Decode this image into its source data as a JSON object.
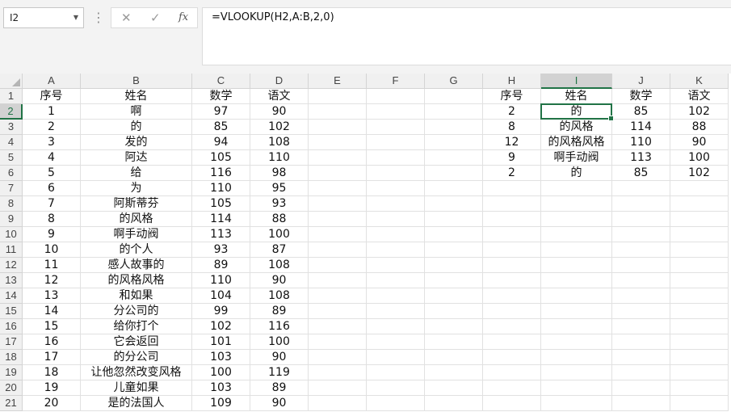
{
  "name_box": {
    "value": "I2"
  },
  "formula_bar": {
    "cancel_icon": "✕",
    "enter_icon": "✓",
    "fx_label": "fx",
    "formula": "=VLOOKUP(H2,A:B,2,0)"
  },
  "columns": [
    "A",
    "B",
    "C",
    "D",
    "E",
    "F",
    "G",
    "H",
    "I",
    "J",
    "K"
  ],
  "rows": [
    "1",
    "2",
    "3",
    "4",
    "5",
    "6",
    "7",
    "8",
    "9",
    "10",
    "11",
    "12",
    "13",
    "14",
    "15",
    "16",
    "17",
    "18",
    "19",
    "20",
    "21"
  ],
  "selected_cell": {
    "col": "I",
    "row": "2"
  },
  "cells": [
    [
      "序号",
      "姓名",
      "数学",
      "语文",
      "",
      "",
      "",
      "序号",
      "姓名",
      "数学",
      "语文"
    ],
    [
      "1",
      "啊",
      "97",
      "90",
      "",
      "",
      "",
      "2",
      "的",
      "85",
      "102"
    ],
    [
      "2",
      "的",
      "85",
      "102",
      "",
      "",
      "",
      "8",
      "的风格",
      "114",
      "88"
    ],
    [
      "3",
      "发的",
      "94",
      "108",
      "",
      "",
      "",
      "12",
      "的风格风格",
      "110",
      "90"
    ],
    [
      "4",
      "阿达",
      "105",
      "110",
      "",
      "",
      "",
      "9",
      "啊手动阀",
      "113",
      "100"
    ],
    [
      "5",
      "给",
      "116",
      "98",
      "",
      "",
      "",
      "2",
      "的",
      "85",
      "102"
    ],
    [
      "6",
      "为",
      "110",
      "95",
      "",
      "",
      "",
      "",
      "",
      "",
      ""
    ],
    [
      "7",
      "阿斯蒂芬",
      "105",
      "93",
      "",
      "",
      "",
      "",
      "",
      "",
      ""
    ],
    [
      "8",
      "的风格",
      "114",
      "88",
      "",
      "",
      "",
      "",
      "",
      "",
      ""
    ],
    [
      "9",
      "啊手动阀",
      "113",
      "100",
      "",
      "",
      "",
      "",
      "",
      "",
      ""
    ],
    [
      "10",
      "的个人",
      "93",
      "87",
      "",
      "",
      "",
      "",
      "",
      "",
      ""
    ],
    [
      "11",
      "感人故事的",
      "89",
      "108",
      "",
      "",
      "",
      "",
      "",
      "",
      ""
    ],
    [
      "12",
      "的风格风格",
      "110",
      "90",
      "",
      "",
      "",
      "",
      "",
      "",
      ""
    ],
    [
      "13",
      "和如果",
      "104",
      "108",
      "",
      "",
      "",
      "",
      "",
      "",
      ""
    ],
    [
      "14",
      "分公司的",
      "99",
      "89",
      "",
      "",
      "",
      "",
      "",
      "",
      ""
    ],
    [
      "15",
      "给你打个",
      "102",
      "116",
      "",
      "",
      "",
      "",
      "",
      "",
      ""
    ],
    [
      "16",
      "它会返回",
      "101",
      "100",
      "",
      "",
      "",
      "",
      "",
      "",
      ""
    ],
    [
      "17",
      "的分公司",
      "103",
      "90",
      "",
      "",
      "",
      "",
      "",
      "",
      ""
    ],
    [
      "18",
      "让他忽然改变风格",
      "100",
      "119",
      "",
      "",
      "",
      "",
      "",
      "",
      ""
    ],
    [
      "19",
      "儿童如果",
      "103",
      "89",
      "",
      "",
      "",
      "",
      "",
      "",
      ""
    ],
    [
      "20",
      "是的法国人",
      "109",
      "90",
      "",
      "",
      "",
      "",
      "",
      "",
      ""
    ]
  ]
}
